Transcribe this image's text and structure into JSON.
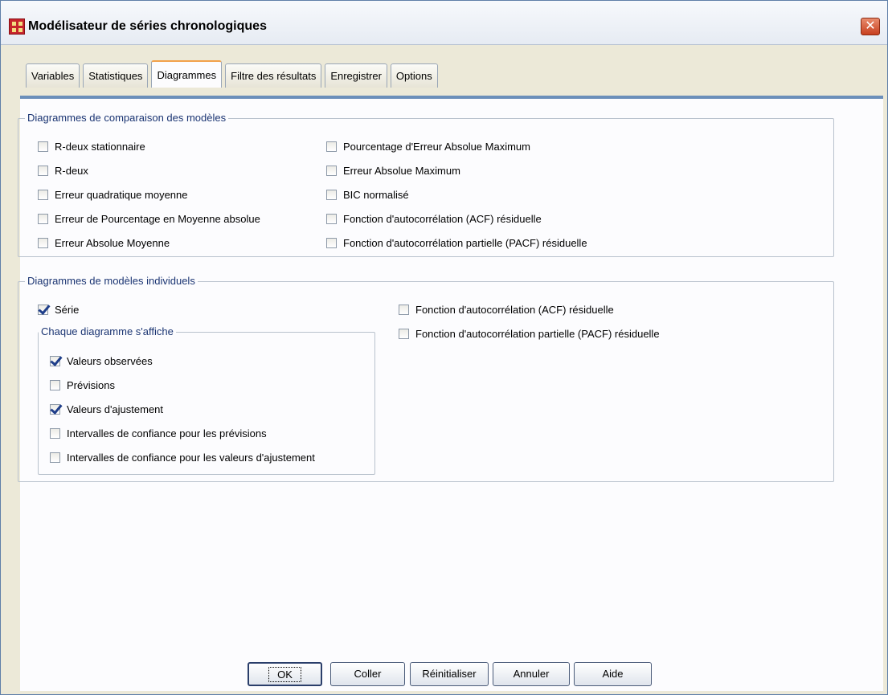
{
  "window": {
    "title": "Modélisateur de séries chronologiques",
    "close_glyph": "✕"
  },
  "tabs": [
    {
      "label": "Variables",
      "active": false
    },
    {
      "label": "Statistiques",
      "active": false
    },
    {
      "label": "Diagrammes",
      "active": true
    },
    {
      "label": "Filtre des résultats",
      "active": false
    },
    {
      "label": "Enregistrer",
      "active": false
    },
    {
      "label": "Options",
      "active": false
    }
  ],
  "model_comparison": {
    "legend": "Diagrammes de comparaison des modèles",
    "left_items": [
      {
        "label": "R-deux stationnaire",
        "checked": false
      },
      {
        "label": "R-deux",
        "checked": false
      },
      {
        "label": "Erreur quadratique moyenne",
        "checked": false
      },
      {
        "label": "Erreur de Pourcentage en Moyenne absolue",
        "checked": false
      },
      {
        "label": "Erreur Absolue Moyenne",
        "checked": false
      }
    ],
    "right_items": [
      {
        "label": "Pourcentage d'Erreur Absolue Maximum",
        "checked": false
      },
      {
        "label": "Erreur Absolue Maximum",
        "checked": false
      },
      {
        "label": "BIC normalisé",
        "checked": false
      },
      {
        "label": "Fonction d'autocorrélation (ACF) résiduelle",
        "checked": false
      },
      {
        "label": "Fonction d'autocorrélation partielle (PACF) résiduelle",
        "checked": false
      }
    ]
  },
  "individual_models": {
    "legend": "Diagrammes de modèles individuels",
    "serie": {
      "label": "Série",
      "checked": true
    },
    "right_items": [
      {
        "label": "Fonction d'autocorrélation (ACF) résiduelle",
        "checked": false
      },
      {
        "label": "Fonction d'autocorrélation partielle (PACF) résiduelle",
        "checked": false
      }
    ],
    "each_plot": {
      "legend": "Chaque diagramme s'affiche",
      "items": [
        {
          "label": "Valeurs observées",
          "checked": true
        },
        {
          "label": "Prévisions",
          "checked": false
        },
        {
          "label": "Valeurs d'ajustement",
          "checked": true
        },
        {
          "label": "Intervalles de confiance pour les prévisions",
          "checked": false
        },
        {
          "label": "Intervalles de confiance pour les valeurs d'ajustement",
          "checked": false
        }
      ]
    }
  },
  "buttons": {
    "ok": "OK",
    "paste": "Coller",
    "reset": "Réinitialiser",
    "cancel": "Annuler",
    "help": "Aide"
  },
  "colors": {
    "accent_tab": "#f2a14a",
    "legend_text": "#1a3472",
    "checkmark": "#1f3e8a"
  }
}
